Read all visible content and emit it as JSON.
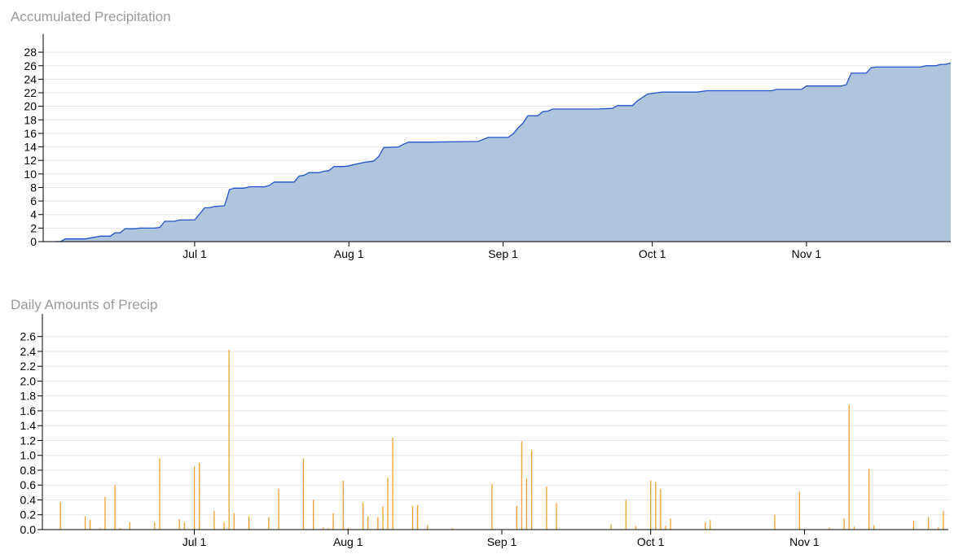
{
  "chart_data": [
    {
      "type": "area",
      "title": "Accumulated Precipitation",
      "xlabel": "",
      "ylabel": "",
      "x_domain": [
        "2024-06-03",
        "2024-11-30"
      ],
      "ylim": [
        0,
        29
      ],
      "y_ticks": [
        0,
        2,
        4,
        6,
        8,
        10,
        12,
        14,
        16,
        18,
        20,
        22,
        24,
        26,
        28
      ],
      "x_ticks": [
        {
          "date": "2024-07-01",
          "label": "Jul 1"
        },
        {
          "date": "2024-08-01",
          "label": "Aug 1"
        },
        {
          "date": "2024-09-01",
          "label": "Sep 1"
        },
        {
          "date": "2024-10-01",
          "label": "Oct 1"
        },
        {
          "date": "2024-11-01",
          "label": "Nov 1"
        }
      ],
      "grid": true,
      "line_color": "#2255cc",
      "fill_color": "#b0c4de",
      "points": [
        [
          "2024-06-03",
          0.0
        ],
        [
          "2024-06-04",
          0.0
        ],
        [
          "2024-06-05",
          0.4
        ],
        [
          "2024-06-09",
          0.4
        ],
        [
          "2024-06-12",
          0.8
        ],
        [
          "2024-06-14",
          0.8
        ],
        [
          "2024-06-15",
          1.3
        ],
        [
          "2024-06-16",
          1.3
        ],
        [
          "2024-06-17",
          1.9
        ],
        [
          "2024-06-19",
          1.9
        ],
        [
          "2024-06-20",
          2.0
        ],
        [
          "2024-06-23",
          2.0
        ],
        [
          "2024-06-24",
          2.1
        ],
        [
          "2024-06-25",
          3.0
        ],
        [
          "2024-06-27",
          3.0
        ],
        [
          "2024-06-28",
          3.2
        ],
        [
          "2024-07-01",
          3.2
        ],
        [
          "2024-07-02",
          4.1
        ],
        [
          "2024-07-03",
          5.0
        ],
        [
          "2024-07-04",
          5.0
        ],
        [
          "2024-07-05",
          5.2
        ],
        [
          "2024-07-07",
          5.3
        ],
        [
          "2024-07-08",
          7.7
        ],
        [
          "2024-07-09",
          7.9
        ],
        [
          "2024-07-11",
          7.9
        ],
        [
          "2024-07-12",
          8.1
        ],
        [
          "2024-07-15",
          8.1
        ],
        [
          "2024-07-16",
          8.3
        ],
        [
          "2024-07-17",
          8.8
        ],
        [
          "2024-07-21",
          8.8
        ],
        [
          "2024-07-22",
          9.7
        ],
        [
          "2024-07-23",
          9.8
        ],
        [
          "2024-07-24",
          10.2
        ],
        [
          "2024-07-26",
          10.2
        ],
        [
          "2024-07-27",
          10.4
        ],
        [
          "2024-07-28",
          10.5
        ],
        [
          "2024-07-29",
          11.1
        ],
        [
          "2024-07-31",
          11.1
        ],
        [
          "2024-08-01",
          11.2
        ],
        [
          "2024-08-04",
          11.7
        ],
        [
          "2024-08-06",
          11.9
        ],
        [
          "2024-08-07",
          12.6
        ],
        [
          "2024-08-08",
          13.9
        ],
        [
          "2024-08-11",
          14.0
        ],
        [
          "2024-08-12",
          14.4
        ],
        [
          "2024-08-13",
          14.7
        ],
        [
          "2024-08-17",
          14.7
        ],
        [
          "2024-08-27",
          14.8
        ],
        [
          "2024-08-29",
          15.4
        ],
        [
          "2024-09-02",
          15.4
        ],
        [
          "2024-09-03",
          15.9
        ],
        [
          "2024-09-04",
          16.8
        ],
        [
          "2024-09-05",
          17.5
        ],
        [
          "2024-09-06",
          18.6
        ],
        [
          "2024-09-08",
          18.6
        ],
        [
          "2024-09-09",
          19.2
        ],
        [
          "2024-09-10",
          19.3
        ],
        [
          "2024-09-11",
          19.6
        ],
        [
          "2024-09-20",
          19.6
        ],
        [
          "2024-09-23",
          19.7
        ],
        [
          "2024-09-24",
          20.1
        ],
        [
          "2024-09-27",
          20.1
        ],
        [
          "2024-09-28",
          20.8
        ],
        [
          "2024-09-30",
          21.8
        ],
        [
          "2024-10-02",
          22.0
        ],
        [
          "2024-10-03",
          22.1
        ],
        [
          "2024-10-10",
          22.1
        ],
        [
          "2024-10-12",
          22.3
        ],
        [
          "2024-10-25",
          22.3
        ],
        [
          "2024-10-26",
          22.5
        ],
        [
          "2024-10-31",
          22.5
        ],
        [
          "2024-11-01",
          23.0
        ],
        [
          "2024-11-08",
          23.0
        ],
        [
          "2024-11-09",
          23.2
        ],
        [
          "2024-11-10",
          24.9
        ],
        [
          "2024-11-13",
          24.9
        ],
        [
          "2024-11-14",
          25.7
        ],
        [
          "2024-11-15",
          25.8
        ],
        [
          "2024-11-24",
          25.8
        ],
        [
          "2024-11-25",
          26.0
        ],
        [
          "2024-11-27",
          26.0
        ],
        [
          "2024-11-28",
          26.2
        ],
        [
          "2024-11-29",
          26.2
        ],
        [
          "2024-11-30",
          26.4
        ]
      ]
    },
    {
      "type": "bar",
      "title": "Daily Amounts of Precip",
      "xlabel": "",
      "ylabel": "",
      "x_domain": [
        "2024-06-03",
        "2024-11-30"
      ],
      "ylim": [
        0,
        2.75
      ],
      "y_ticks": [
        0.0,
        0.2,
        0.4,
        0.6,
        0.8,
        1.0,
        1.2,
        1.4,
        1.6,
        1.8,
        2.0,
        2.2,
        2.4,
        2.6
      ],
      "y_tick_labels": [
        "0.0",
        "0.2",
        "0.4",
        "0.6",
        "0.8",
        "1.0",
        "1.2",
        "1.4",
        "1.6",
        "1.8",
        "2.0",
        "2.2",
        "2.4",
        "2.6"
      ],
      "x_ticks": [
        {
          "date": "2024-07-01",
          "label": "Jul 1"
        },
        {
          "date": "2024-08-01",
          "label": "Aug 1"
        },
        {
          "date": "2024-09-01",
          "label": "Sep 1"
        },
        {
          "date": "2024-10-01",
          "label": "Oct 1"
        },
        {
          "date": "2024-11-01",
          "label": "Nov 1"
        }
      ],
      "grid": true,
      "bar_color": "#f0a030",
      "bars": [
        [
          "2024-06-04",
          0.37
        ],
        [
          "2024-06-09",
          0.18
        ],
        [
          "2024-06-10",
          0.13
        ],
        [
          "2024-06-12",
          0.02
        ],
        [
          "2024-06-13",
          0.44
        ],
        [
          "2024-06-15",
          0.6
        ],
        [
          "2024-06-16",
          0.02
        ],
        [
          "2024-06-18",
          0.1
        ],
        [
          "2024-06-23",
          0.1
        ],
        [
          "2024-06-24",
          0.96
        ],
        [
          "2024-06-28",
          0.14
        ],
        [
          "2024-06-29",
          0.1
        ],
        [
          "2024-07-01",
          0.85
        ],
        [
          "2024-07-02",
          0.9
        ],
        [
          "2024-07-05",
          0.25
        ],
        [
          "2024-07-07",
          0.1
        ],
        [
          "2024-07-08",
          2.42
        ],
        [
          "2024-07-09",
          0.22
        ],
        [
          "2024-07-12",
          0.18
        ],
        [
          "2024-07-16",
          0.17
        ],
        [
          "2024-07-18",
          0.55
        ],
        [
          "2024-07-23",
          0.96
        ],
        [
          "2024-07-25",
          0.4
        ],
        [
          "2024-07-27",
          0.03
        ],
        [
          "2024-07-28",
          0.02
        ],
        [
          "2024-07-29",
          0.22
        ],
        [
          "2024-07-31",
          0.66
        ],
        [
          "2024-08-01",
          0.02
        ],
        [
          "2024-08-04",
          0.36
        ],
        [
          "2024-08-05",
          0.18
        ],
        [
          "2024-08-07",
          0.17
        ],
        [
          "2024-08-08",
          0.31
        ],
        [
          "2024-08-09",
          0.7
        ],
        [
          "2024-08-10",
          1.24
        ],
        [
          "2024-08-14",
          0.32
        ],
        [
          "2024-08-15",
          0.33
        ],
        [
          "2024-08-17",
          0.06
        ],
        [
          "2024-08-22",
          0.02
        ],
        [
          "2024-08-30",
          0.61
        ],
        [
          "2024-09-04",
          0.32
        ],
        [
          "2024-09-05",
          1.19
        ],
        [
          "2024-09-06",
          0.69
        ],
        [
          "2024-09-07",
          1.07
        ],
        [
          "2024-09-10",
          0.58
        ],
        [
          "2024-09-12",
          0.36
        ],
        [
          "2024-09-23",
          0.07
        ],
        [
          "2024-09-26",
          0.4
        ],
        [
          "2024-09-28",
          0.05
        ],
        [
          "2024-10-01",
          0.66
        ],
        [
          "2024-10-02",
          0.64
        ],
        [
          "2024-10-03",
          0.55
        ],
        [
          "2024-10-04",
          0.05
        ],
        [
          "2024-10-05",
          0.15
        ],
        [
          "2024-10-12",
          0.1
        ],
        [
          "2024-10-13",
          0.13
        ],
        [
          "2024-10-26",
          0.2
        ],
        [
          "2024-10-31",
          0.51
        ],
        [
          "2024-11-06",
          0.03
        ],
        [
          "2024-11-09",
          0.15
        ],
        [
          "2024-11-10",
          1.68
        ],
        [
          "2024-11-11",
          0.04
        ],
        [
          "2024-11-14",
          0.82
        ],
        [
          "2024-11-15",
          0.06
        ],
        [
          "2024-11-23",
          0.12
        ],
        [
          "2024-11-26",
          0.17
        ],
        [
          "2024-11-28",
          0.03
        ],
        [
          "2024-11-29",
          0.25
        ]
      ]
    }
  ]
}
